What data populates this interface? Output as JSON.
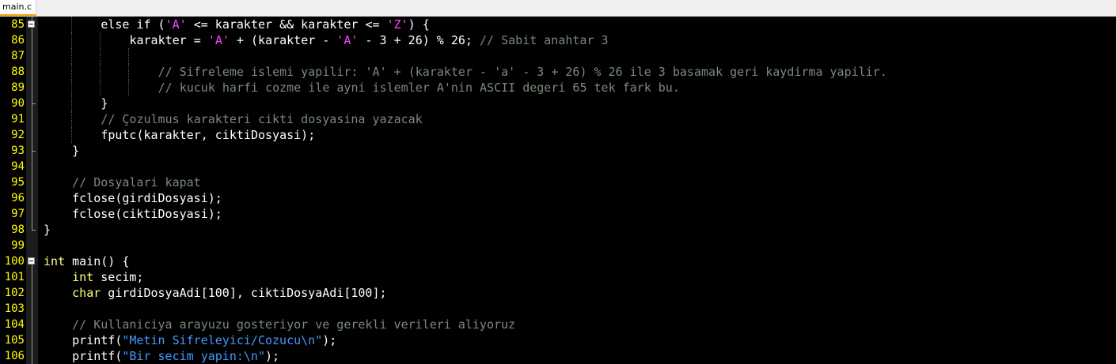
{
  "tab": {
    "filename": "main.c"
  },
  "lines": [
    {
      "no": "85",
      "indent": 2,
      "segments": [
        {
          "t": "else if (",
          "c": ""
        },
        {
          "t": "'A'",
          "c": "ch"
        },
        {
          "t": " <= karakter && karakter <= ",
          "c": ""
        },
        {
          "t": "'Z'",
          "c": "ch"
        },
        {
          "t": ") {",
          "c": ""
        }
      ]
    },
    {
      "no": "86",
      "indent": 3,
      "segments": [
        {
          "t": "karakter = ",
          "c": ""
        },
        {
          "t": "'A'",
          "c": "ch"
        },
        {
          "t": " + (karakter - ",
          "c": ""
        },
        {
          "t": "'A'",
          "c": "ch"
        },
        {
          "t": " - 3 + 26) % 26; ",
          "c": ""
        },
        {
          "t": "// Sabit anahtar 3",
          "c": "cm"
        }
      ]
    },
    {
      "no": "87",
      "indent": 0,
      "segments": []
    },
    {
      "no": "88",
      "indent": 4,
      "segments": [
        {
          "t": "// Sifreleme islemi yapilir: 'A' + (karakter - 'a' - 3 + 26) % 26 ile 3 basamak geri kaydirma yapilir.",
          "c": "cm"
        }
      ]
    },
    {
      "no": "89",
      "indent": 4,
      "segments": [
        {
          "t": "// kucuk harfi cozme ile ayni islemler A'nin ASCII degeri 65 tek fark bu.",
          "c": "cm"
        }
      ]
    },
    {
      "no": "90",
      "indent": 2,
      "segments": [
        {
          "t": "}",
          "c": ""
        }
      ]
    },
    {
      "no": "91",
      "indent": 2,
      "segments": [
        {
          "t": "// Çozulmus karakteri cikti dosyasina yazacak",
          "c": "cm"
        }
      ]
    },
    {
      "no": "92",
      "indent": 2,
      "segments": [
        {
          "t": "fputc(karakter, ciktiDosyasi);",
          "c": ""
        }
      ]
    },
    {
      "no": "93",
      "indent": 1,
      "segments": [
        {
          "t": "}",
          "c": ""
        }
      ]
    },
    {
      "no": "94",
      "indent": 0,
      "segments": []
    },
    {
      "no": "95",
      "indent": 1,
      "segments": [
        {
          "t": "// Dosyalari kapat",
          "c": "cm"
        }
      ]
    },
    {
      "no": "96",
      "indent": 1,
      "segments": [
        {
          "t": "fclose(girdiDosyasi);",
          "c": ""
        }
      ]
    },
    {
      "no": "97",
      "indent": 1,
      "segments": [
        {
          "t": "fclose(ciktiDosyasi);",
          "c": ""
        }
      ]
    },
    {
      "no": "98",
      "indent": 0,
      "segments": [
        {
          "t": "}",
          "c": ""
        }
      ]
    },
    {
      "no": "99",
      "indent": 0,
      "segments": []
    },
    {
      "no": "100",
      "indent": 0,
      "segments": [
        {
          "t": "int",
          "c": "ty"
        },
        {
          "t": " main() {",
          "c": ""
        }
      ]
    },
    {
      "no": "101",
      "indent": 1,
      "segments": [
        {
          "t": "int",
          "c": "ty"
        },
        {
          "t": " secim;",
          "c": ""
        }
      ]
    },
    {
      "no": "102",
      "indent": 1,
      "segments": [
        {
          "t": "char",
          "c": "ty"
        },
        {
          "t": " girdiDosyaAdi[100], ciktiDosyaAdi[100];",
          "c": ""
        }
      ]
    },
    {
      "no": "103",
      "indent": 0,
      "segments": []
    },
    {
      "no": "104",
      "indent": 1,
      "segments": [
        {
          "t": "// Kullaniciya arayuzu gosteriyor ve gerekli verileri aliyoruz",
          "c": "cm"
        }
      ]
    },
    {
      "no": "105",
      "indent": 1,
      "segments": [
        {
          "t": "printf(",
          "c": ""
        },
        {
          "t": "\"Metin Sifreleyici/Cozucu\\n\"",
          "c": "str"
        },
        {
          "t": ");",
          "c": ""
        }
      ]
    },
    {
      "no": "106",
      "indent": 1,
      "segments": [
        {
          "t": "printf(",
          "c": ""
        },
        {
          "t": "\"Bir secim yapin:\\n\"",
          "c": "str"
        },
        {
          "t": ");",
          "c": ""
        }
      ]
    }
  ],
  "colors": {
    "background": "#000000",
    "line_numbers": "#ffff00",
    "keyword": "#ffff80",
    "char_literal": "#ff44ff",
    "string_literal": "#4499ff",
    "comment": "#7a8a7a"
  }
}
